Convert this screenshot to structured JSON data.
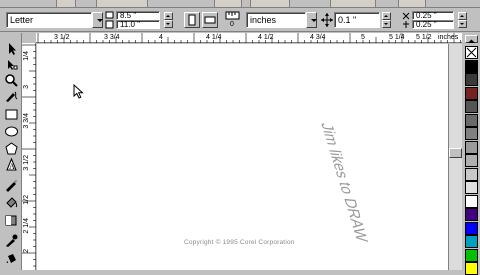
{
  "property_bar": {
    "paper_type": "Letter",
    "page_width": "8.5 \"",
    "page_height": "11.0 \"",
    "units_label": "0",
    "units": "inches",
    "nudge": "0.1 \"",
    "dup_x": "0.25 \"",
    "dup_y": "0.25 \""
  },
  "rulers": {
    "horizontal_labels": [
      "3 1/2",
      "3 3/4",
      "4",
      "4 1/4",
      "4 1/2",
      "4 3/4",
      "5",
      "5 1/4",
      "5 1/2",
      "inches"
    ],
    "vertical_labels": [
      "1/4",
      "3",
      "3 3/4",
      "3 1/2",
      "1/2",
      "2 1/4",
      "2"
    ]
  },
  "canvas": {
    "artistic_text": "Jim likes to DRAW",
    "copyright": "Copyright © 1995 Corel Corporation"
  },
  "colors": {
    "palette": [
      "#ffffff",
      "#000000",
      "#3a3a3a",
      "#772222",
      "#555555",
      "#6a6a6a",
      "#808080",
      "#9a9a9a",
      "#b0b0b0",
      "#c8c8c8",
      "#e0e0e0",
      "#ffffff",
      "#400080",
      "#0000ff",
      "#00a0c0",
      "#00c000",
      "#ffff00"
    ]
  },
  "icons": [
    "pick-tool-icon",
    "shape-tool-icon",
    "zoom-tool-icon",
    "freehand-tool-icon",
    "rectangle-tool-icon",
    "ellipse-tool-icon",
    "polygon-tool-icon",
    "text-tool-icon",
    "outline-tool-icon",
    "fill-tool-icon",
    "eyedropper-icon",
    "mouse-pointer-icon"
  ]
}
